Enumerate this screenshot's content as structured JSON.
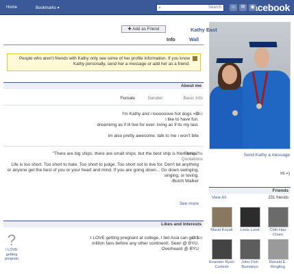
{
  "topbar": {
    "logo": "facebook",
    "search_placeholder": "Search",
    "nav_home": "Home",
    "nav_bookmarks": "Bookmarks ▾"
  },
  "profile": {
    "name": "Kathy East",
    "add_friend": "Add as Friend",
    "tabs": [
      "Wall",
      "Info"
    ],
    "send_message": "Send Kathy a message",
    "bio_short": "Hi =)"
  },
  "notice": {
    "text": "People who aren't friends with Kathy only see some of her profile information. If you know Kathy personally, send her a message or add her as a friend."
  },
  "about": {
    "header": "About me",
    "basic_info_label": "Basic Info",
    "gender_label": "Gender:",
    "gender_value": "Female",
    "bio_label": "Bio",
    "bio_lines": [
      "I'm Kathy and i loooooove hot dogs =D",
      "i like to have fun.",
      "dreamimg as if ill live for ever. living as if its my last.",
      "",
      "im also pretty awesome. talk to me i won't bite"
    ],
    "quotes_label": "Favourite Quotations",
    "quotes_lines": [
      "\"There are big ships. there are small ships. but the best ship is friendship.\"",
      "",
      "Life is too short. Too short to hate. Too short to judge. Too short not to live for. Don't let anything or anyone get the best of you or your heart and mind. If you are going down... Go down swinging, singing, or loving.",
      "-Butch Walker"
    ],
    "see_more": "See more"
  },
  "likes": {
    "header": "Likes and Interests",
    "other_label": "Other",
    "other_lines": [
      "I LOVE getting pregnant at college, I bet Asia can get 1",
      "million fans before any other continent!, Seen @ BYU,",
      "Overheard @ BYU"
    ],
    "question_caption": "I LOVE getting pregnan"
  },
  "friends": {
    "header": "Friends",
    "count": "231 friends",
    "view_all": "View All",
    "items": [
      {
        "name": "Chih Hao Chien",
        "color": "#6b6b6b"
      },
      {
        "name": "Lexis Lund",
        "color": "#2c2c2c"
      },
      {
        "name": "Murat Koçak",
        "color": "#8a7760"
      },
      {
        "name": "Ronald E. Ringling",
        "color": "#9a9a9a"
      },
      {
        "name": "John Fish Bumabyo",
        "color": "#5d5d5d"
      },
      {
        "name": "Evander Ryan Cortesh",
        "color": "#444444"
      }
    ]
  }
}
